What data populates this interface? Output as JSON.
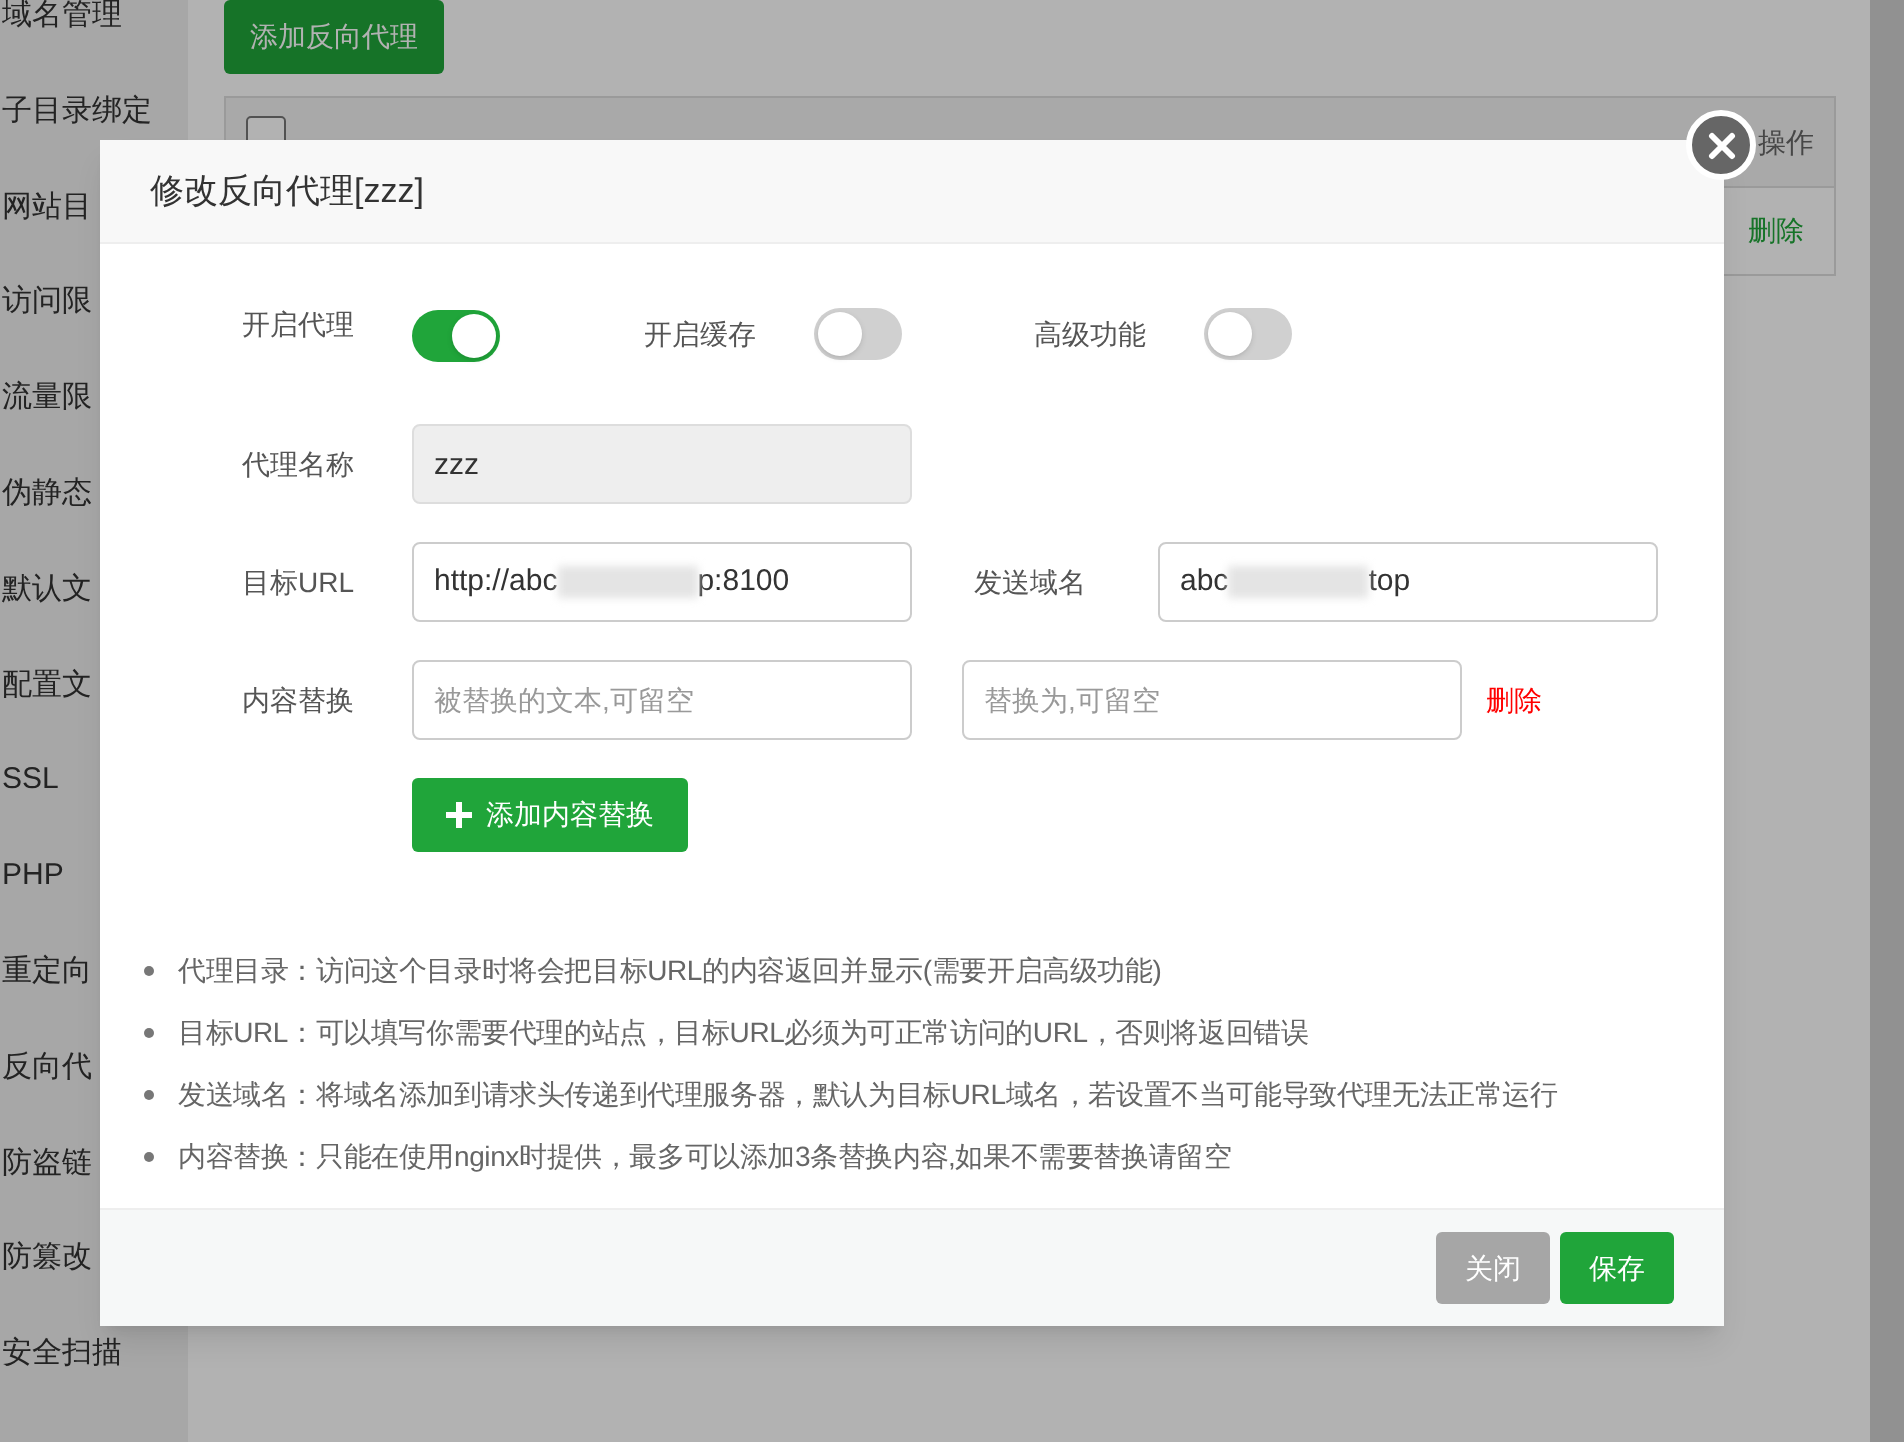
{
  "sidebar": {
    "items": [
      "域名管理",
      "子目录绑定",
      "网站目",
      "访问限",
      "流量限",
      "伪静态",
      "默认文",
      "配置文",
      "SSL",
      "PHP",
      "重定向",
      "反向代",
      "防盗链",
      "防篡改",
      "安全扫描"
    ]
  },
  "page": {
    "add_button": "添加反向代理",
    "table": {
      "select_all_checked": false,
      "action_header": "操作",
      "row_action": "删除"
    }
  },
  "dialog": {
    "title": "修改反向代理[zzz]",
    "toggles": [
      {
        "label": "开启代理",
        "on": true
      },
      {
        "label": "开启缓存",
        "on": false
      },
      {
        "label": "高级功能",
        "on": false
      }
    ],
    "name_field": {
      "label": "代理名称",
      "value": "zzz",
      "disabled": true
    },
    "target_field": {
      "label": "目标URL",
      "value_parts": [
        "http://abc",
        "p:8100"
      ]
    },
    "send_domain_field": {
      "label": "发送域名",
      "value_parts": [
        "abc",
        "top"
      ]
    },
    "replace_row": {
      "label": "内容替换",
      "from_placeholder": "被替换的文本,可留空",
      "to_placeholder": "替换为,可留空",
      "delete": "删除"
    },
    "add_replace_button": "添加内容替换",
    "notes": [
      "代理目录：访问这个目录时将会把目标URL的内容返回并显示(需要开启高级功能)",
      "目标URL：可以填写你需要代理的站点，目标URL必须为可正常访问的URL，否则将返回错误",
      "发送域名：将域名添加到请求头传递到代理服务器，默认为目标URL域名，若设置不当可能导致代理无法正常运行",
      "内容替换：只能在使用nginx时提供，最多可以添加3条替换内容,如果不需要替换请留空"
    ],
    "buttons": [
      {
        "label": "关闭",
        "kind": "secondary"
      },
      {
        "label": "保存",
        "kind": "primary"
      }
    ]
  }
}
